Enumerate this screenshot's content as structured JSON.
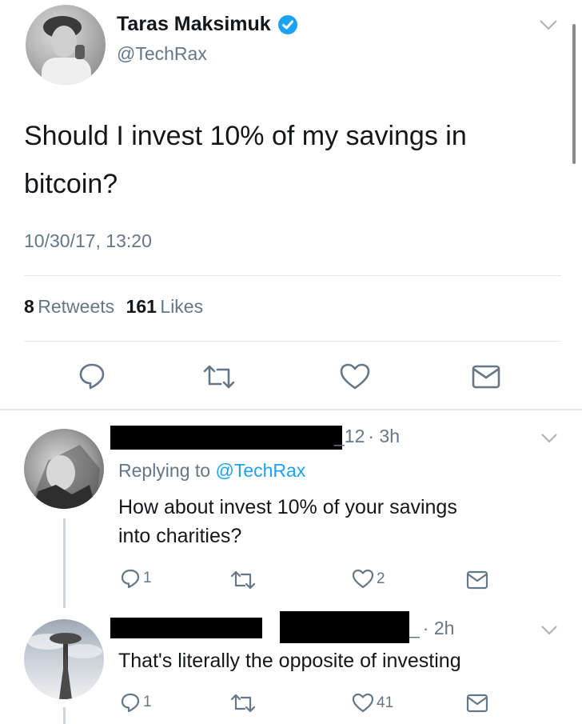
{
  "main_tweet": {
    "author_name": "Taras Maksimuk",
    "verified": true,
    "handle": "@TechRax",
    "text_line1": "Should I invest 10% of my savings in",
    "text_line2": "bitcoin?",
    "timestamp": "10/30/17, 13:20",
    "retweet_count": "8",
    "retweet_label": "Retweets",
    "like_count": "161",
    "like_label": "Likes"
  },
  "replies": [
    {
      "handle_suffix": "_12",
      "time": "· 3h",
      "replying_prefix": "Replying to",
      "replying_to": "@TechRax",
      "text_line1": "How about invest 10% of your savings",
      "text_line2": "into charities?",
      "reply_count": "1",
      "like_count": "2"
    },
    {
      "handle_suffix": "_",
      "time": "· 2h",
      "text_line1": "That's literally the opposite of investing",
      "reply_count": "1",
      "like_count": "41"
    }
  ],
  "colors": {
    "accent": "#1da1f2",
    "secondary_text": "#657786",
    "divider": "#e1e8ed"
  }
}
